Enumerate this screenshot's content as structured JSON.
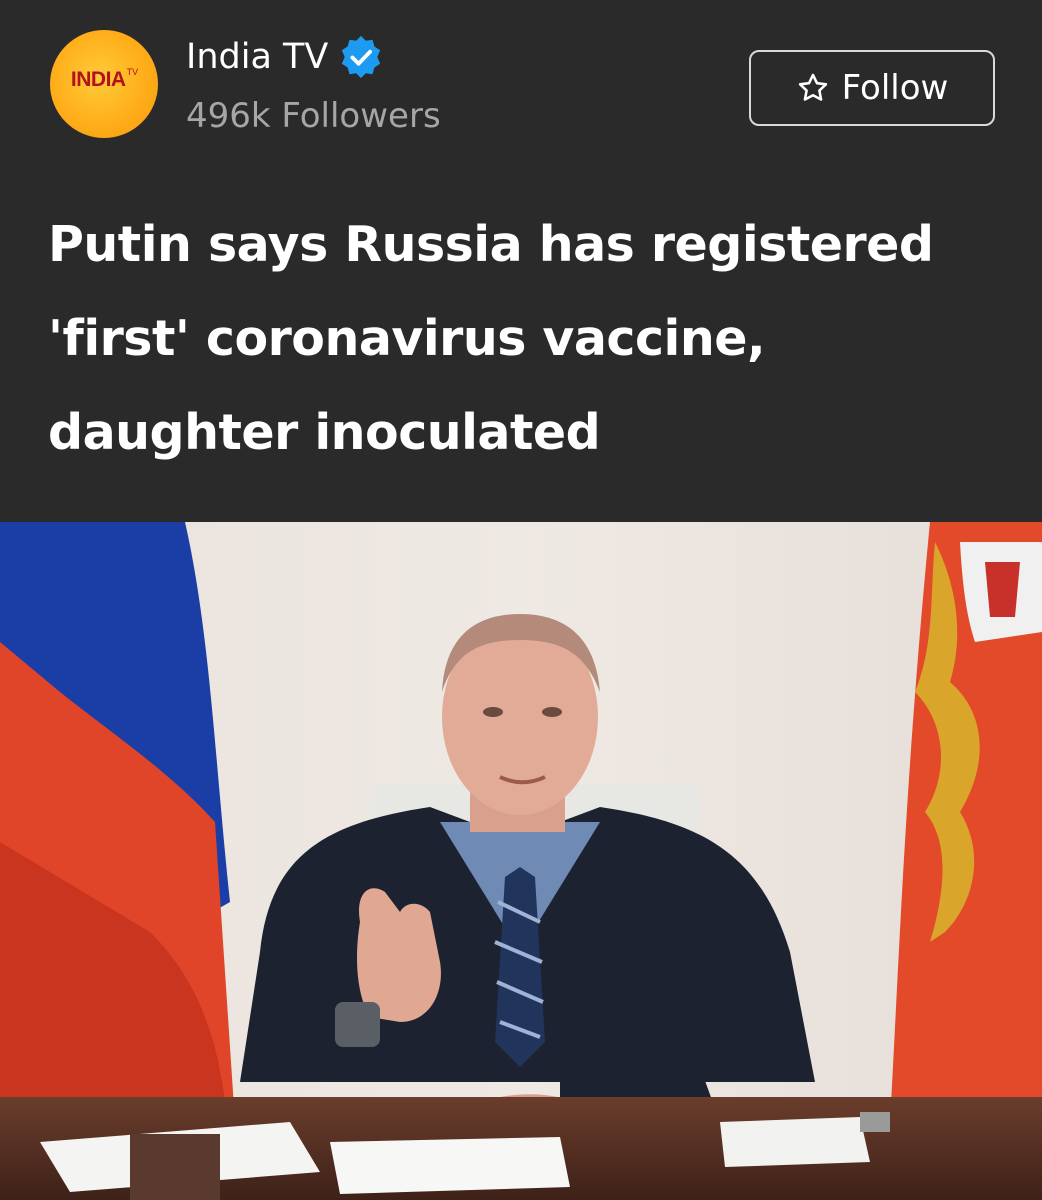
{
  "channel": {
    "name": "India TV",
    "followers": "496k Followers",
    "logo_text": "INDIA",
    "logo_sup": "TV",
    "verified_icon": "verified-badge-icon"
  },
  "follow_button": {
    "label": "Follow",
    "icon": "star-outline-icon"
  },
  "article": {
    "headline": "Putin says Russia has registered 'first' coronavirus vaccine, daughter inoculated"
  },
  "colors": {
    "background": "#2a2a2a",
    "logo_orange": "#ffae1a",
    "logo_red": "#b3121d",
    "verified_blue": "#1d9bf0",
    "secondary_text": "#a6a6a6"
  }
}
